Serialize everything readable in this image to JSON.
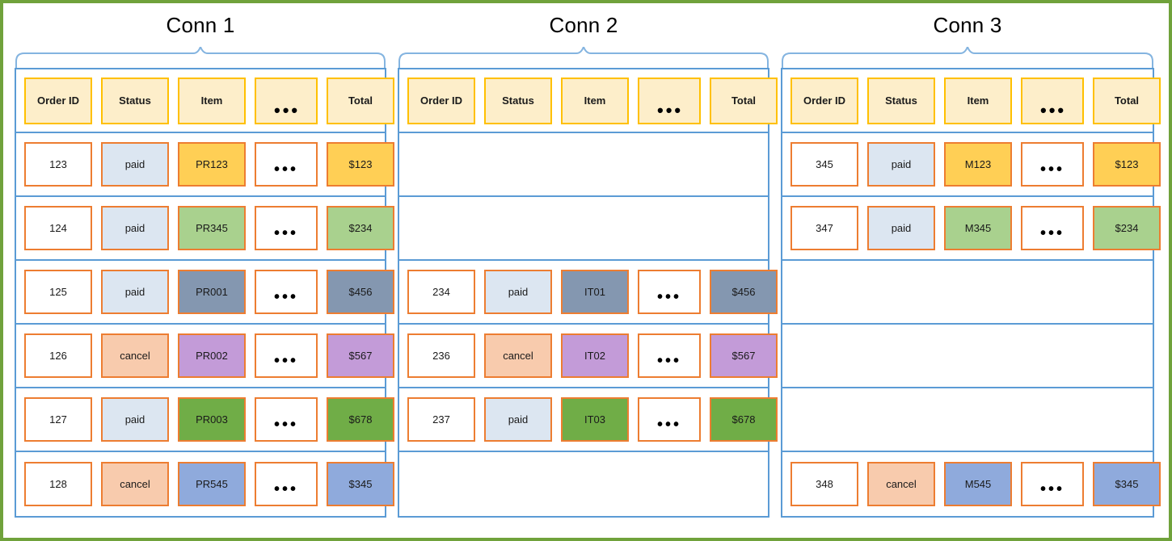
{
  "diagram": {
    "outer_border_color": "#70a23b",
    "panel_border_color": "#5b9bd5",
    "header_cell_border_color": "#ffc000",
    "header_cell_fill_color": "#fdeeca",
    "data_cell_border_color": "#ed7d31",
    "ellipsis_glyph": "•••"
  },
  "columns": [
    {
      "key": "order_id",
      "label": "Order ID"
    },
    {
      "key": "status",
      "label": "Status"
    },
    {
      "key": "item",
      "label": "Item"
    },
    {
      "key": "more",
      "label": "•••"
    },
    {
      "key": "total",
      "label": "Total"
    }
  ],
  "panels": [
    {
      "title": "Conn 1",
      "rows": [
        {
          "empty": false,
          "order_id": "123",
          "status": "paid",
          "item": "PR123",
          "total": "$123",
          "status_color": "#dce6f1",
          "item_color": "#ffcf55",
          "total_color": "#ffcf55"
        },
        {
          "empty": false,
          "order_id": "124",
          "status": "paid",
          "item": "PR345",
          "total": "$234",
          "status_color": "#dce6f1",
          "item_color": "#a9d18e",
          "total_color": "#a9d18e"
        },
        {
          "empty": false,
          "order_id": "125",
          "status": "paid",
          "item": "PR001",
          "total": "$456",
          "status_color": "#dce6f1",
          "item_color": "#8497b0",
          "total_color": "#8497b0"
        },
        {
          "empty": false,
          "order_id": "126",
          "status": "cancel",
          "item": "PR002",
          "total": "$567",
          "status_color": "#f8cbad",
          "item_color": "#c39bd8",
          "total_color": "#c39bd8"
        },
        {
          "empty": false,
          "order_id": "127",
          "status": "paid",
          "item": "PR003",
          "total": "$678",
          "status_color": "#dce6f1",
          "item_color": "#70ad47",
          "total_color": "#70ad47"
        },
        {
          "empty": false,
          "order_id": "128",
          "status": "cancel",
          "item": "PR545",
          "total": "$345",
          "status_color": "#f8cbad",
          "item_color": "#8faadc",
          "total_color": "#8faadc"
        }
      ]
    },
    {
      "title": "Conn 2",
      "rows": [
        {
          "empty": true
        },
        {
          "empty": true
        },
        {
          "empty": false,
          "order_id": "234",
          "status": "paid",
          "item": "IT01",
          "total": "$456",
          "status_color": "#dce6f1",
          "item_color": "#8497b0",
          "total_color": "#8497b0"
        },
        {
          "empty": false,
          "order_id": "236",
          "status": "cancel",
          "item": "IT02",
          "total": "$567",
          "status_color": "#f8cbad",
          "item_color": "#c39bd8",
          "total_color": "#c39bd8"
        },
        {
          "empty": false,
          "order_id": "237",
          "status": "paid",
          "item": "IT03",
          "total": "$678",
          "status_color": "#dce6f1",
          "item_color": "#70ad47",
          "total_color": "#70ad47"
        },
        {
          "empty": true
        }
      ]
    },
    {
      "title": "Conn 3",
      "rows": [
        {
          "empty": false,
          "order_id": "345",
          "status": "paid",
          "item": "M123",
          "total": "$123",
          "status_color": "#dce6f1",
          "item_color": "#ffcf55",
          "total_color": "#ffcf55"
        },
        {
          "empty": false,
          "order_id": "347",
          "status": "paid",
          "item": "M345",
          "total": "$234",
          "status_color": "#dce6f1",
          "item_color": "#a9d18e",
          "total_color": "#a9d18e"
        },
        {
          "empty": true
        },
        {
          "empty": true
        },
        {
          "empty": true
        },
        {
          "empty": false,
          "order_id": "348",
          "status": "cancel",
          "item": "M545",
          "total": "$345",
          "status_color": "#f8cbad",
          "item_color": "#8faadc",
          "total_color": "#8faadc"
        }
      ]
    }
  ]
}
